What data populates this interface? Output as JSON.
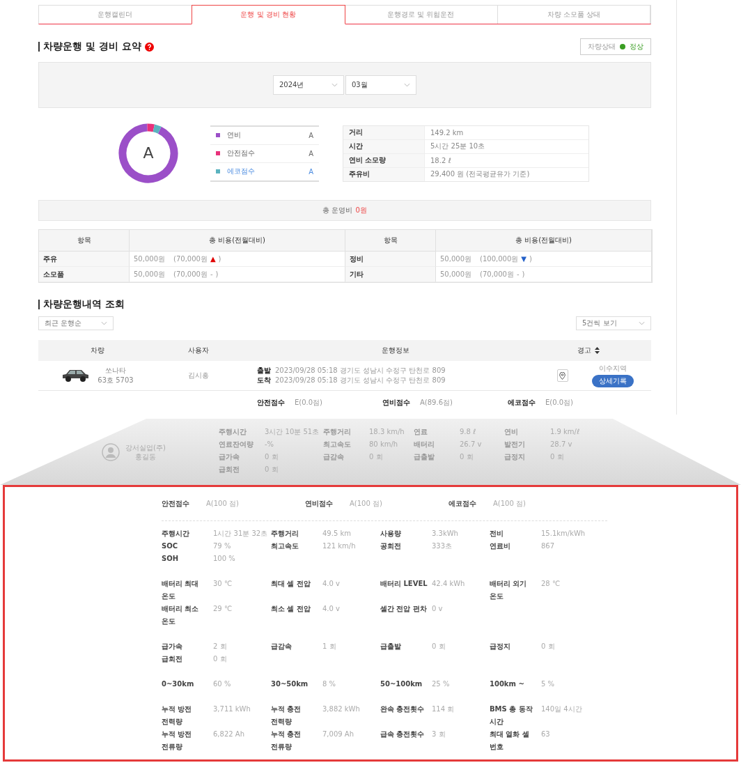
{
  "tabs": [
    {
      "label": "운행캘린더",
      "selected": false
    },
    {
      "label": "운행 및 경비 현황",
      "selected": true
    },
    {
      "label": "운행경로 및 위험운전",
      "selected": false
    },
    {
      "label": "차량 소모품 상태",
      "selected": false
    }
  ],
  "summary": {
    "title": "차량운행 및 경비 요약",
    "status_label": "차량상태",
    "status_value": "정상",
    "year": "2024년",
    "month": "03월",
    "grade": "A",
    "legend": [
      {
        "label": "연비",
        "grade": "A",
        "color": "#9b4fc8",
        "selected": false
      },
      {
        "label": "안전점수",
        "grade": "A",
        "color": "#e8317a",
        "selected": false
      },
      {
        "label": "에코점수",
        "grade": "A",
        "color": "#5bb3bf",
        "selected": true
      }
    ],
    "stats": [
      {
        "label": "거리",
        "value": "149.2 km"
      },
      {
        "label": "시간",
        "value": "5시간 25분 10초"
      },
      {
        "label": "연비 소모량",
        "value": "18.2 ℓ"
      },
      {
        "label": "주유비",
        "value": "29,400 원 (전국평균유가 기준)"
      }
    ],
    "total_label": "총 운영비",
    "total_value": "0원",
    "cost_headers": [
      "항목",
      "총 비용(전월대비)",
      "항목",
      "총 비용(전월대비)"
    ],
    "costs": [
      {
        "item": "주유",
        "amount": "50,000원",
        "previous": "(70,000원",
        "color": "#e00000",
        "symbol": "▲",
        "close": ")"
      },
      {
        "item": "정비",
        "amount": "50,000원",
        "previous": "(100,000원",
        "color": "#2460c8",
        "symbol": "▼",
        "close": ")"
      },
      {
        "item": "소모품",
        "amount": "50,000원",
        "previous": "(70,000원",
        "symbol": "-",
        "close": ")"
      },
      {
        "item": "기타",
        "amount": "50,000원",
        "previous": "(70,000원",
        "symbol": "-",
        "close": ")"
      }
    ]
  },
  "history": {
    "title": "차량운행내역 조회",
    "sort": "최근 운행순",
    "page_size": "5건씩 보기",
    "columns": [
      "차량",
      "사용자",
      "운행정보",
      "경고"
    ],
    "row": {
      "car": "쏘나타",
      "plate": "63호 5703",
      "user": "김시흥",
      "depart_label": "출발",
      "depart": "2023/09/28 05:18 경기도 성남시 수정구 탄천로 809",
      "arrive_label": "도착",
      "arrive": "2023/09/28 05:18 경기도 성남시 수정구 탄천로 809",
      "warning": "이수지역",
      "detail_button": "상세기록"
    },
    "scores": [
      {
        "label": "안전점수",
        "value": "E(0.0점)"
      },
      {
        "label": "연비점수",
        "value": "A(89.6점)"
      },
      {
        "label": "에코점수",
        "value": "E(0.0점)"
      }
    ],
    "faded": {
      "company": "강서실업(주)",
      "user": "홍길동",
      "stats": [
        {
          "label": "주행시간",
          "value": "3시간 10분 51초"
        },
        {
          "label": "주행거리",
          "value": "18.3 km/h"
        },
        {
          "label": "연료",
          "value": "9.8 ℓ"
        },
        {
          "label": "연비",
          "value": "1.9 km/ℓ"
        },
        {
          "label": "연료잔여량",
          "value": "-%"
        },
        {
          "label": "최고속도",
          "value": "80 km/h"
        },
        {
          "label": "배터리",
          "value": "26.7 v"
        },
        {
          "label": "발전기",
          "value": "28.7 v"
        },
        {
          "label": "급가속",
          "value": "0 회"
        },
        {
          "label": "급감속",
          "value": "0 회"
        },
        {
          "label": "급출발",
          "value": "0 회"
        },
        {
          "label": "급정지",
          "value": "0 회"
        },
        {
          "label": "급회전",
          "value": "0 회"
        }
      ]
    }
  },
  "detail": {
    "scores": [
      {
        "label": "안전점수",
        "value": "A(100 점)"
      },
      {
        "label": "연비점수",
        "value": "A(100 점)"
      },
      {
        "label": "에코점수",
        "value": "A(100 점)"
      }
    ],
    "groups": [
      [
        {
          "label": "주행시간",
          "value": "1시간 31분 32초"
        },
        {
          "label": "주행거리",
          "value": "49.5 km"
        },
        {
          "label": "사용량",
          "value": "3.3kWh"
        },
        {
          "label": "전비",
          "value": "15.1km/kWh"
        },
        {
          "label": "SOC",
          "value": "79 %"
        },
        {
          "label": "최고속도",
          "value": "121 km/h"
        },
        {
          "label": "공회전",
          "value": "333초"
        },
        {
          "label": "연료비",
          "value": "867"
        },
        {
          "label": "SOH",
          "value": "100 %"
        }
      ],
      [
        {
          "label": "배터리 최대 온도",
          "value": "30 ℃"
        },
        {
          "label": "최대 셀 전압",
          "value": "4.0 v"
        },
        {
          "label": "배터리 LEVEL",
          "value": "42.4 kWh"
        },
        {
          "label": "배터리 외기 온도",
          "value": "28 ℃"
        },
        {
          "label": "배터리 최소 온도",
          "value": "29 ℃"
        },
        {
          "label": "최소 셀 전압",
          "value": "4.0 v"
        },
        {
          "label": "셀간 전압 편차",
          "value": "0 v"
        }
      ],
      [
        {
          "label": "급가속",
          "value": "2 회"
        },
        {
          "label": "급감속",
          "value": "1 회"
        },
        {
          "label": "급출발",
          "value": "0 회"
        },
        {
          "label": "급정지",
          "value": "0 회"
        },
        {
          "label": "급회전",
          "value": "0 회"
        }
      ],
      [
        {
          "label": "0~30km",
          "value": "60 %"
        },
        {
          "label": "30~50km",
          "value": "8 %"
        },
        {
          "label": "50~100km",
          "value": "25 %"
        },
        {
          "label": "100km ~",
          "value": "5 %"
        }
      ],
      [
        {
          "label": "누적 방전 전력량",
          "value": "3,711 kWh"
        },
        {
          "label": "누적 충전 전력량",
          "value": "3,882 kWh"
        },
        {
          "label": "완속 충전횟수",
          "value": "114 회"
        },
        {
          "label": "BMS 총 동작 시간",
          "value": "140일 4시간"
        },
        {
          "label": "누적 방전 전류량",
          "value": "6,822 Ah"
        },
        {
          "label": "누적 충전 전류량",
          "value": "7,009 Ah"
        },
        {
          "label": "급속 충전횟수",
          "value": "3 회"
        },
        {
          "label": "최대 열화 셀 번호",
          "value": "63"
        }
      ]
    ]
  }
}
